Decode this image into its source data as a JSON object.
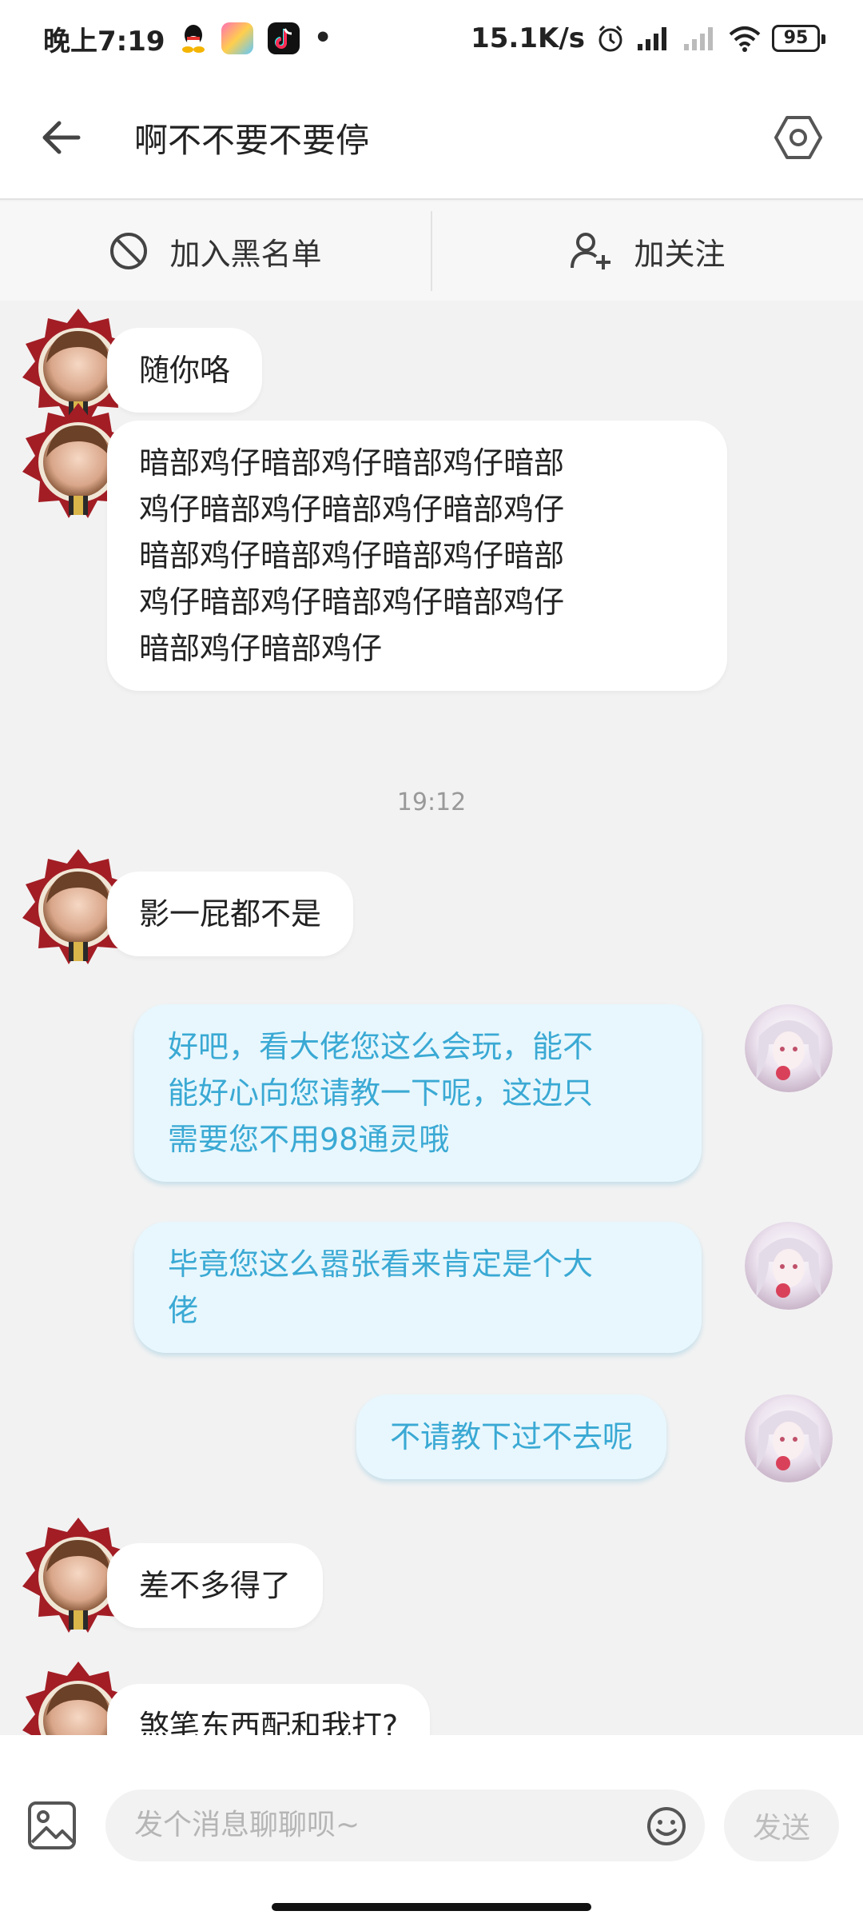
{
  "status_bar": {
    "time": "晚上7:19",
    "net_speed": "15.1K/s",
    "battery": "95"
  },
  "header": {
    "title": "啊不不要不要停"
  },
  "actions": {
    "block": "加入黑名单",
    "follow": "加关注"
  },
  "messages": [
    {
      "side": "in",
      "text": "随你咯"
    },
    {
      "side": "in",
      "lines": [
        "暗部鸡仔暗部鸡仔暗部鸡仔暗部",
        "鸡仔暗部鸡仔暗部鸡仔暗部鸡仔",
        "暗部鸡仔暗部鸡仔暗部鸡仔暗部",
        "鸡仔暗部鸡仔暗部鸡仔暗部鸡仔",
        "暗部鸡仔暗部鸡仔"
      ]
    },
    {
      "type": "time",
      "text": "19:12"
    },
    {
      "side": "in",
      "text": "影一屁都不是"
    },
    {
      "side": "out",
      "lines": [
        "好吧，看大佬您这么会玩，能不",
        "能好心向您请教一下呢，这边只",
        "需要您不用98通灵哦"
      ]
    },
    {
      "side": "out",
      "lines": [
        "毕竟您这么嚣张看来肯定是个大",
        "佬"
      ]
    },
    {
      "side": "out",
      "text": "不请教下过不去呢"
    },
    {
      "side": "in",
      "text": "差不多得了"
    },
    {
      "side": "in",
      "text": "煞笔东西配和我打?"
    }
  ],
  "input": {
    "placeholder": "发个消息聊聊呗~",
    "send_label": "发送"
  },
  "colors": {
    "outgoing_bubble": "#e8f7fd",
    "outgoing_text": "#3aa9d4",
    "incoming_bubble": "#ffffff"
  }
}
